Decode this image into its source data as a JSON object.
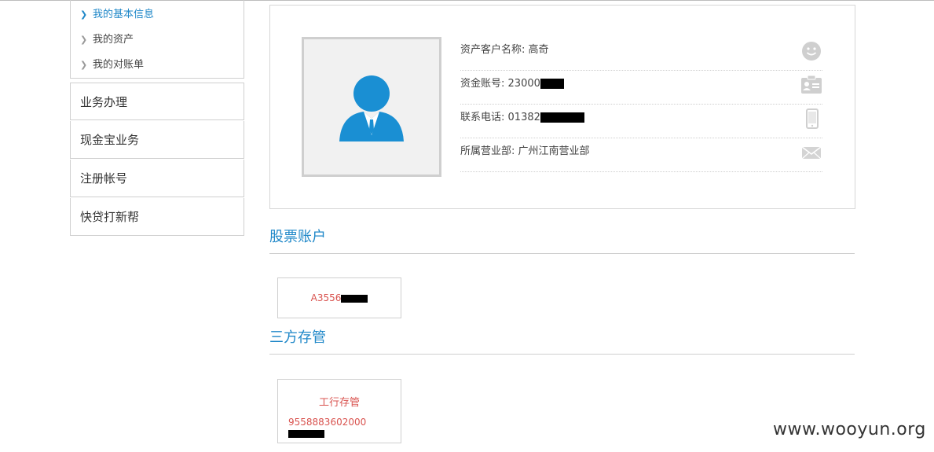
{
  "sidebar": {
    "sub_items": [
      {
        "label": "我的基本信息",
        "active": true
      },
      {
        "label": "我的资产",
        "active": false
      },
      {
        "label": "我的对账单",
        "active": false
      }
    ],
    "nav_items": [
      {
        "label": "业务办理"
      },
      {
        "label": "现金宝业务"
      },
      {
        "label": "注册帐号"
      },
      {
        "label": "快贷打新帮"
      }
    ]
  },
  "profile": {
    "rows": [
      {
        "label": "资产客户名称:",
        "value": "高奇",
        "icon": "smiley-icon"
      },
      {
        "label": "资金账号:",
        "value": "23000",
        "icon": "id-card-icon"
      },
      {
        "label": "联系电话:",
        "value": "01382",
        "icon": "mobile-phone-icon"
      },
      {
        "label": "所属营业部:",
        "value": "广州江南营业部",
        "icon": "mail-envelope-icon"
      }
    ]
  },
  "stock_section": {
    "title": "股票账户",
    "account": "A3556"
  },
  "bank_section": {
    "title": "三方存管",
    "bank_name": "工行存管",
    "account": "9558883602000"
  },
  "watermark": "www.wooyun.org",
  "colors": {
    "accent": "#1e87c8",
    "account_red": "#d9534f",
    "border": "#cfcfcf"
  }
}
